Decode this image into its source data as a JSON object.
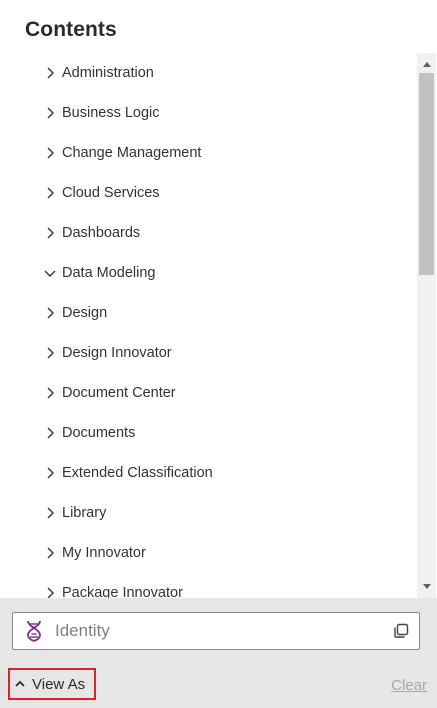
{
  "panel": {
    "title": "Contents"
  },
  "tree": {
    "items": [
      {
        "label": "Administration",
        "expanded": false
      },
      {
        "label": "Business Logic",
        "expanded": false
      },
      {
        "label": "Change Management",
        "expanded": false
      },
      {
        "label": "Cloud Services",
        "expanded": false
      },
      {
        "label": "Dashboards",
        "expanded": false
      },
      {
        "label": "Data Modeling",
        "expanded": true
      },
      {
        "label": "Design",
        "expanded": false
      },
      {
        "label": "Design Innovator",
        "expanded": false
      },
      {
        "label": "Document Center",
        "expanded": false
      },
      {
        "label": "Documents",
        "expanded": false
      },
      {
        "label": "Extended Classification",
        "expanded": false
      },
      {
        "label": "Library",
        "expanded": false
      },
      {
        "label": "My Innovator",
        "expanded": false
      },
      {
        "label": "Package Innovator",
        "expanded": false
      }
    ]
  },
  "identity": {
    "placeholder": "Identity",
    "icon": "dna-icon",
    "action_icon": "copy-icon"
  },
  "footer": {
    "view_as_label": "View As",
    "clear_label": "Clear"
  },
  "colors": {
    "highlight_border": "#d9232d",
    "dna_icon": "#7b2d8e",
    "footer_bg": "#e6e6e6"
  }
}
